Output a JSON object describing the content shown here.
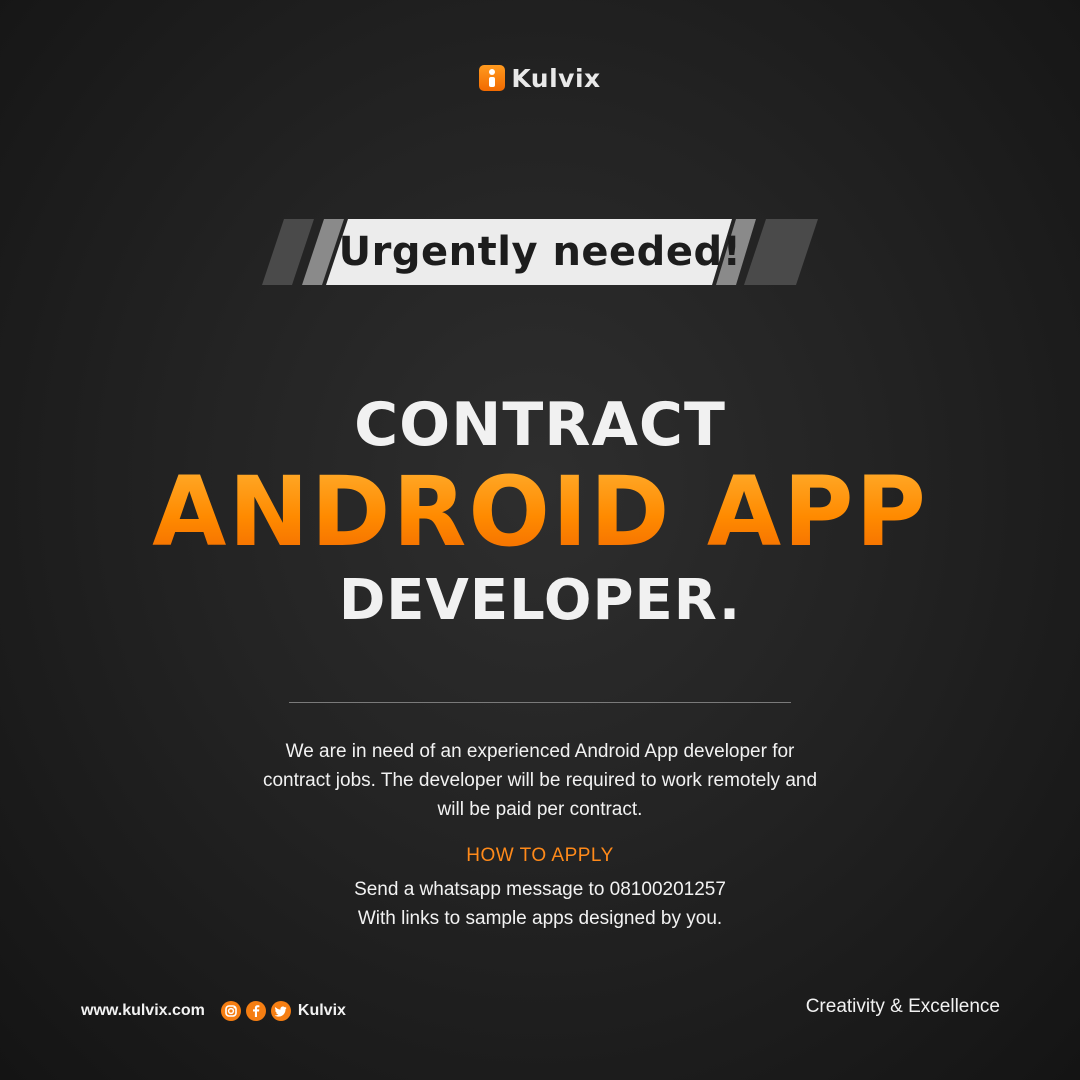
{
  "brand": {
    "name": "Kulvix",
    "accent": "#ff8a00"
  },
  "banner": {
    "label": "Urgently needed!"
  },
  "headline": {
    "line1": "CONTRACT",
    "line2": "ANDROID APP",
    "line3": "DEVELOPER."
  },
  "description": {
    "line1": "We are in need of an experienced Android App developer for",
    "line2": "contract jobs. The developer will be required to work remotely and",
    "line3": "will be paid per contract."
  },
  "how_to_apply": {
    "title": "HOW TO APPLY",
    "line1": "Send a whatsapp message to 08100201257",
    "line2": "With links to sample apps designed by you."
  },
  "footer": {
    "website": "www.kulvix.com",
    "social_icons": [
      "instagram-icon",
      "facebook-icon",
      "twitter-icon"
    ],
    "handle": "Kulvix",
    "tagline": "Creativity & Excellence"
  }
}
